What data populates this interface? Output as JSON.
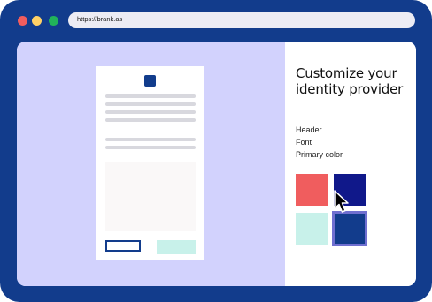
{
  "browser": {
    "url": "https://brank.as",
    "window_controls": [
      "close",
      "minimize",
      "maximize"
    ]
  },
  "panel": {
    "title": "Customize your identity provider",
    "options": [
      "Header",
      "Font",
      "Primary color"
    ],
    "swatches": [
      {
        "name": "coral",
        "color": "#f05d5e"
      },
      {
        "name": "navy",
        "color": "#10188a"
      },
      {
        "name": "mint",
        "color": "#c8f1ea"
      },
      {
        "name": "blue",
        "color": "#123c8c",
        "selected": true
      }
    ]
  },
  "colors": {
    "frame": "#123c8c",
    "preview_bg": "#d2d2fd",
    "accent": "#123c8c"
  }
}
